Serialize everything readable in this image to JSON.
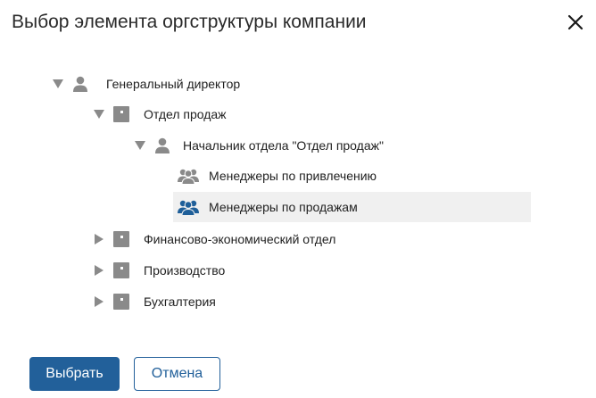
{
  "dialog": {
    "title": "Выбор элемента оргструктуры компании",
    "close_icon": "close-icon"
  },
  "tree": {
    "nodes": [
      {
        "label": "Генеральный директор",
        "icon": "person-icon",
        "state": "expanded",
        "level": 0
      },
      {
        "label": "Отдел продаж",
        "icon": "department-icon",
        "state": "expanded",
        "level": 1
      },
      {
        "label": "Начальник отдела \"Отдел продаж\"",
        "icon": "person-icon",
        "state": "expanded",
        "level": 2
      },
      {
        "label": "Менеджеры по привлечению",
        "icon": "group-icon",
        "state": "leaf",
        "level": 3
      },
      {
        "label": "Менеджеры по продажам",
        "icon": "group-icon",
        "state": "leaf",
        "level": 3,
        "selected": true
      },
      {
        "label": "Финансово-экономический отдел",
        "icon": "department-icon",
        "state": "collapsed",
        "level": 1
      },
      {
        "label": "Производство",
        "icon": "department-icon",
        "state": "collapsed",
        "level": 1
      },
      {
        "label": "Бухгалтерия",
        "icon": "department-icon",
        "state": "collapsed",
        "level": 1
      }
    ]
  },
  "buttons": {
    "select_label": "Выбрать",
    "cancel_label": "Отмена"
  },
  "colors": {
    "accent": "#22609a",
    "icon_gray": "#8a8a8a",
    "selected_bg": "#f0f0f0",
    "selected_icon": "#1f5f99"
  }
}
